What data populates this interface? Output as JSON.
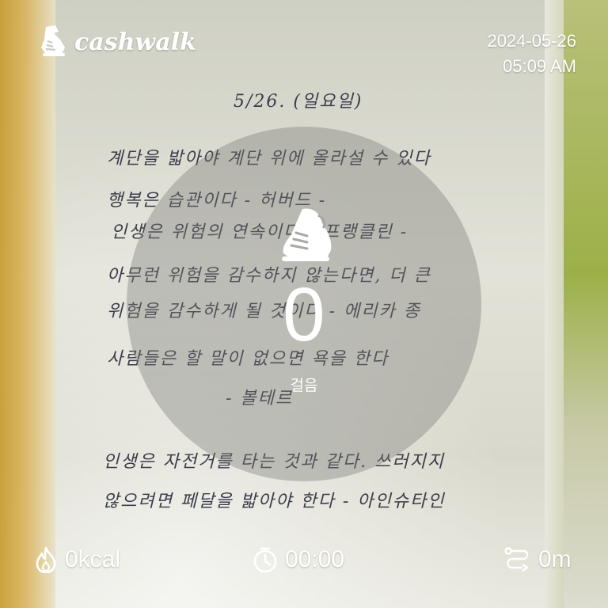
{
  "app": {
    "brand": "cashwalk",
    "logo_icon": "shoe-icon"
  },
  "header": {
    "date": "2024-05-26",
    "time": "05:09 AM"
  },
  "main": {
    "steps": "0",
    "steps_label": "걸음",
    "center_icon": "sneaker-icon"
  },
  "stats": {
    "calories": {
      "icon": "flame-icon",
      "value": "0kcal"
    },
    "duration": {
      "icon": "stopwatch-icon",
      "value": "00:00"
    },
    "distance": {
      "icon": "route-icon",
      "value": "0m"
    }
  },
  "background": {
    "handwriting": [
      "5/26. (일요일)",
      "계단을 밟아야 계단 위에 올라설 수 있다",
      "행복은 습관이다 - 허버드 -",
      "인생은 위험의 연속이다 - 프랭클린 -",
      "아무런 위험을 감수하지 않는다면, 더 큰",
      "위험을 감수하게 될 것이다 - 에리카 종",
      "사람들은 할 말이 없으면 욕을 한다",
      "- 볼테르",
      "인생은 자전거를 타는 것과 같다. 쓰러지지",
      "않으려면 페달을 밟아야 한다 - 아인슈타인"
    ]
  }
}
